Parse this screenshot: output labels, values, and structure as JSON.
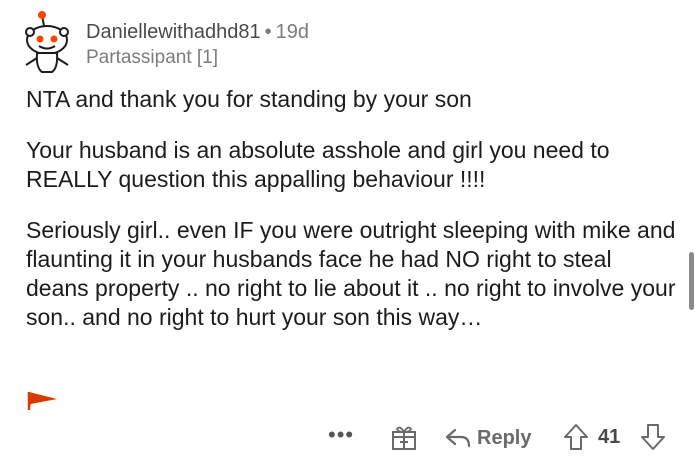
{
  "comment": {
    "username": "Daniellewithadhd81",
    "separator": "•",
    "age": "19d",
    "flair": "Partassipant [1]",
    "paragraphs": [
      "NTA and thank you for standing by your son",
      "Your husband is an absolute asshole and girl you need to REALLY question this appalling behaviour !!!!",
      "Seriously girl.. even IF you were outright sleeping with mike and flaunting it in your husbands face he had NO right to steal deans property .. no right to lie about it .. no right to involve your son.. and no right to hurt your son this way…"
    ]
  },
  "actions": {
    "more": "•••",
    "reply_label": "Reply",
    "score": "41"
  },
  "icons": {
    "avatar": "snoo-avatar-icon",
    "flag": "flag-icon",
    "award": "gift-icon",
    "reply": "reply-arrow-icon",
    "upvote": "upvote-arrow-icon",
    "downvote": "downvote-arrow-icon"
  },
  "colors": {
    "flag": "#d93a00",
    "avatar_accent": "#ff4500"
  }
}
